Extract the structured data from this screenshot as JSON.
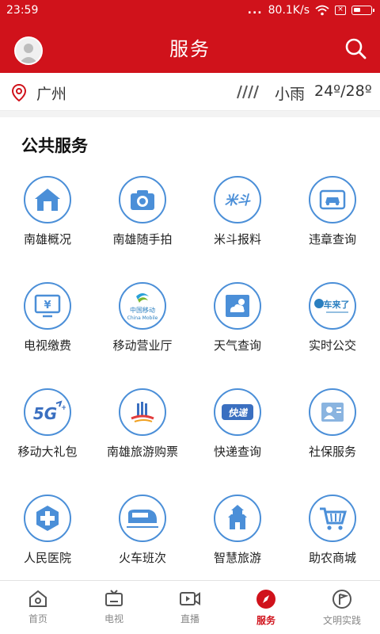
{
  "status_bar": {
    "time": "23:59",
    "signal_dots": "...",
    "speed": "80.1K/s",
    "wifi_icon": "wifi-icon",
    "sim_icon": "sim-off-icon",
    "battery_icon": "battery-icon"
  },
  "header": {
    "title": "服务",
    "avatar_icon": "avatar",
    "search_icon": "search-icon",
    "brand_color": "#d0121b"
  },
  "location": {
    "city": "广州",
    "weather": "小雨",
    "temperature": "24º/28º",
    "location_icon": "map-pin-icon",
    "weather_icon": "rain-icon"
  },
  "services": {
    "title": "公共服务",
    "items": [
      {
        "label": "南雄概况",
        "icon": "house-icon"
      },
      {
        "label": "南雄随手拍",
        "icon": "camera-icon"
      },
      {
        "label": "米斗报料",
        "icon": "midou-icon"
      },
      {
        "label": "违章查询",
        "icon": "car-icon"
      },
      {
        "label": "电视缴费",
        "icon": "tv-yuan-icon"
      },
      {
        "label": "移动营业厅",
        "icon": "china-mobile-icon"
      },
      {
        "label": "天气查询",
        "icon": "weather-icon"
      },
      {
        "label": "实时公交",
        "icon": "bus-icon"
      },
      {
        "label": "移动大礼包",
        "icon": "5g-icon"
      },
      {
        "label": "南雄旅游购票",
        "icon": "tourism-ticket-icon"
      },
      {
        "label": "快递查询",
        "icon": "express-icon"
      },
      {
        "label": "社保服务",
        "icon": "id-card-icon"
      },
      {
        "label": "人民医院",
        "icon": "hospital-cross-icon"
      },
      {
        "label": "火车班次",
        "icon": "train-icon"
      },
      {
        "label": "智慧旅游",
        "icon": "pagoda-icon"
      },
      {
        "label": "助农商城",
        "icon": "shopping-cart-icon"
      }
    ],
    "icon_badge_text": {
      "midou": "米斗",
      "china_mobile_cn": "中国移动",
      "china_mobile_en": "China Mobile",
      "bus": "车来了",
      "express": "快递",
      "fiveg": "5G",
      "tv_yuan": "¥"
    }
  },
  "tabbar": {
    "tabs": [
      {
        "label": "首页",
        "icon": "home-icon",
        "active": false
      },
      {
        "label": "电视",
        "icon": "tv-icon",
        "active": false
      },
      {
        "label": "直播",
        "icon": "video-icon",
        "active": false
      },
      {
        "label": "服务",
        "icon": "compass-icon",
        "active": true
      },
      {
        "label": "文明实践",
        "icon": "flag-circle-icon",
        "active": false
      }
    ]
  }
}
